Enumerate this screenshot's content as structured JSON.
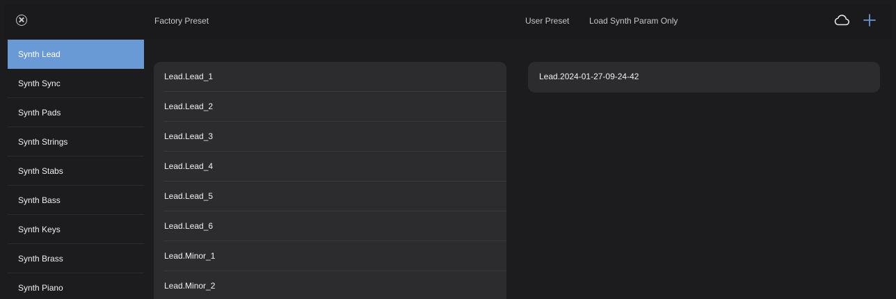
{
  "header": {
    "factory_label": "Factory Preset",
    "user_label": "User Preset",
    "load_only_label": "Load Synth Param Only",
    "icons": [
      "close-circle-icon",
      "cloud-icon",
      "plus-icon"
    ]
  },
  "categories": [
    "Synth Lead",
    "Synth Sync",
    "Synth Pads",
    "Synth Strings",
    "Synth Stabs",
    "Synth Bass",
    "Synth Keys",
    "Synth Brass",
    "Synth Piano"
  ],
  "selected_category": "Synth Lead",
  "factory_presets": [
    "Lead.Lead_1",
    "Lead.Lead_2",
    "Lead.Lead_3",
    "Lead.Lead_4",
    "Lead.Lead_5",
    "Lead.Lead_6",
    "Lead.Minor_1",
    "Lead.Minor_2"
  ],
  "user_presets": [
    "Lead.2024-01-27-09-24-42"
  ],
  "colors": {
    "accent": "#6a9ad6",
    "background": "#1c1c1e",
    "panel": "#2c2c2e"
  }
}
